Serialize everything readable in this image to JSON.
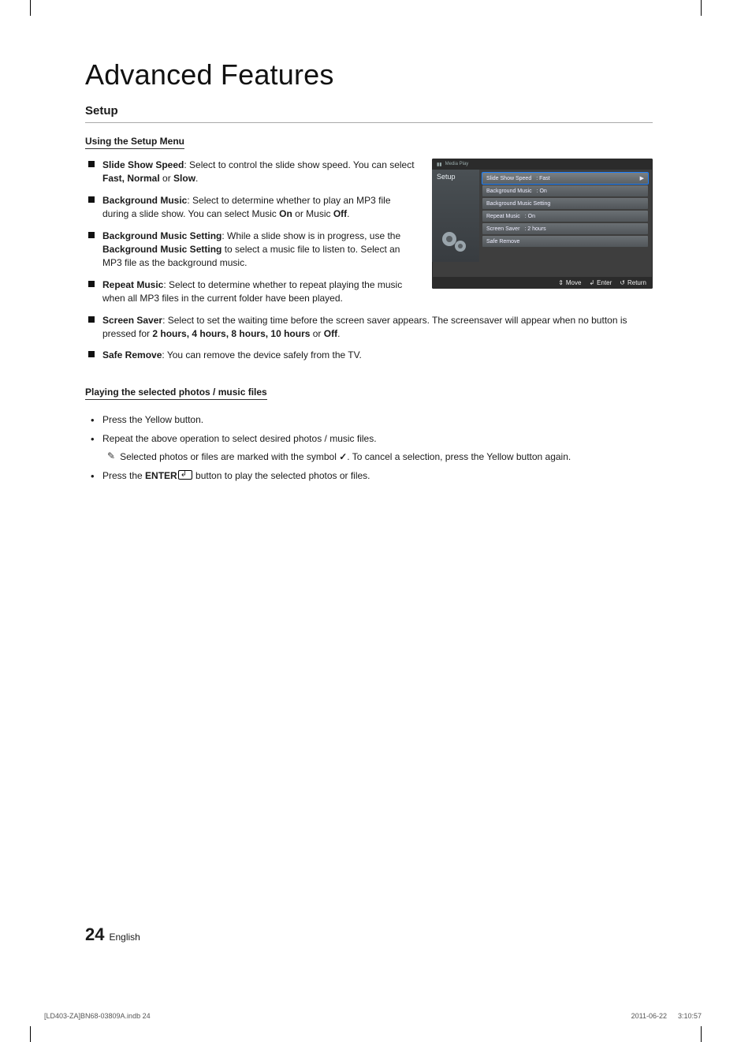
{
  "title": "Advanced Features",
  "section": "Setup",
  "sub1": "Using the Setup Menu",
  "items": [
    {
      "label": "Slide Show Speed",
      "plain": ": Select to control the slide show speed. You can select ",
      "bold2": "Fast, Normal",
      "plain2": " or ",
      "bold3": "Slow",
      "plain3": "."
    },
    {
      "label": "Background Music",
      "plain": ": Select to determine whether to play an MP3 file during a slide show. You can select Music ",
      "bold2": "On",
      "plain2": " or Music ",
      "bold3": "Off",
      "plain3": "."
    },
    {
      "label": "Background Music Setting",
      "plain": ": While a slide show is in progress, use the ",
      "bold2": "Background Music Setting",
      "plain2": " to select a music file to listen to. Select an MP3 file as the background music.",
      "bold3": "",
      "plain3": ""
    },
    {
      "label": "Repeat Music",
      "plain": ": Select to determine whether to repeat playing the music when all MP3 files in the current folder have been played.",
      "bold2": "",
      "plain2": "",
      "bold3": "",
      "plain3": ""
    }
  ],
  "items_full": [
    {
      "label": "Screen Saver",
      "plain": ": Select to set the waiting time before the screen saver appears. The screensaver will appear when no button is pressed for ",
      "bold2": "2 hours, 4 hours, 8 hours, 10 hours",
      "plain2": " or ",
      "bold3": "Off",
      "plain3": "."
    },
    {
      "label": "Safe Remove",
      "plain": ": You can remove the device safely from the TV.",
      "bold2": "",
      "plain2": "",
      "bold3": "",
      "plain3": ""
    }
  ],
  "sub2": "Playing the selected photos / music files",
  "play": {
    "b1": "Press the Yellow button.",
    "b2": "Repeat the above operation to select desired photos / music files.",
    "note_pre": "Selected photos or files are marked with the symbol ",
    "note_post": ". To cancel a selection, press the Yellow button again.",
    "b3_pre": "Press the ",
    "b3_bold": "ENTER",
    "b3_post": " button to play the selected photos or files."
  },
  "tv": {
    "top": "Media Play",
    "left": "Setup",
    "rows": [
      {
        "l": "Slide Show Speed",
        "v": ": Fast",
        "sel": true
      },
      {
        "l": "Background Music",
        "v": ": On"
      },
      {
        "l": "Background Music Setting",
        "v": ""
      },
      {
        "l": "Repeat Music",
        "v": ": On"
      },
      {
        "l": "Screen Saver",
        "v": ": 2 hours"
      },
      {
        "l": "Safe Remove",
        "v": ""
      }
    ],
    "foot": {
      "move": "Move",
      "enter": "Enter",
      "ret": "Return"
    }
  },
  "footer": {
    "page": "24",
    "lang": "English",
    "path": "[LD403-ZA]BN68-03809A.indb   24",
    "ts": "2011-06-22      3:10:57"
  }
}
